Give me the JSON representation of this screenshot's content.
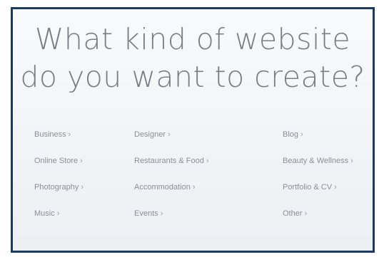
{
  "headline": {
    "line1": "What kind of website",
    "line2": "do you want to create?"
  },
  "categories": {
    "business": "Business",
    "designer": "Designer",
    "blog": "Blog",
    "online_store": "Online Store",
    "restaurants_food": "Restaurants & Food",
    "beauty_wellness": "Beauty & Wellness",
    "photography": "Photography",
    "accommodation": "Accommodation",
    "portfolio_cv": "Portfolio & CV",
    "music": "Music",
    "events": "Events",
    "other": "Other"
  },
  "arrow": "›",
  "colors": {
    "frame": "#1b3a5c",
    "headline": "#7a7d81",
    "link": "#8a9096"
  }
}
